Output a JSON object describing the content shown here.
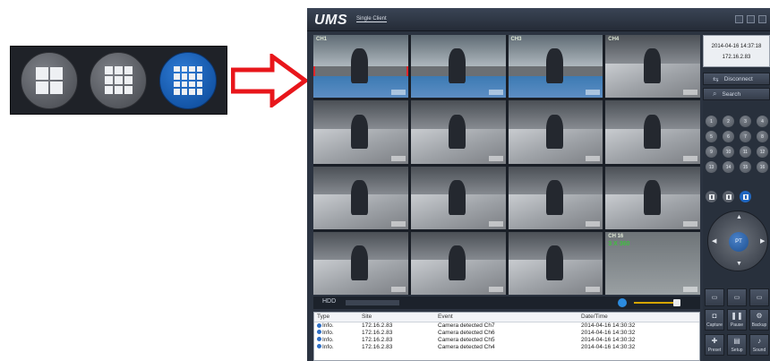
{
  "app": {
    "logo": "UMS",
    "subtitle": "Single Client"
  },
  "layout_buttons": [
    {
      "name": "2x2",
      "active": false
    },
    {
      "name": "3x3",
      "active": false
    },
    {
      "name": "4x4",
      "active": true
    }
  ],
  "cameras": [
    {
      "label": "CH1",
      "osd": "",
      "selected": true,
      "scene": "office"
    },
    {
      "label": "",
      "osd": "",
      "selected": false,
      "scene": "office"
    },
    {
      "label": "CH3",
      "osd": "",
      "selected": false,
      "scene": "office"
    },
    {
      "label": "CH4",
      "osd": "",
      "selected": false,
      "scene": "hall"
    },
    {
      "label": "",
      "osd": "",
      "selected": false,
      "scene": "hall"
    },
    {
      "label": "",
      "osd": "",
      "selected": false,
      "scene": "hall"
    },
    {
      "label": "",
      "osd": "",
      "selected": false,
      "scene": "hall"
    },
    {
      "label": "",
      "osd": "",
      "selected": false,
      "scene": "hall"
    },
    {
      "label": "",
      "osd": "",
      "selected": false,
      "scene": "hall"
    },
    {
      "label": "",
      "osd": "",
      "selected": false,
      "scene": "hall"
    },
    {
      "label": "",
      "osd": "",
      "selected": false,
      "scene": "hall"
    },
    {
      "label": "",
      "osd": "",
      "selected": false,
      "scene": "hall"
    },
    {
      "label": "",
      "osd": "",
      "selected": false,
      "scene": "hall"
    },
    {
      "label": "",
      "osd": "",
      "selected": false,
      "scene": "hall"
    },
    {
      "label": "",
      "osd": "",
      "selected": false,
      "scene": "hall"
    },
    {
      "label": "CH 16",
      "osd": "3 X 360",
      "selected": false,
      "scene": "blank"
    }
  ],
  "status": {
    "hdd_label": "HDD"
  },
  "event_log": {
    "columns": [
      "Type",
      "Site",
      "Event",
      "Date/Time"
    ],
    "rows": [
      [
        "Info.",
        "172.16.2.83",
        "Camera detected Ch7",
        "2014-04-16 14:30:32"
      ],
      [
        "Info.",
        "172.16.2.83",
        "Camera detected Ch6",
        "2014-04-16 14:30:32"
      ],
      [
        "Info.",
        "172.16.2.83",
        "Camera detected Ch5",
        "2014-04-16 14:30:32"
      ],
      [
        "Info.",
        "172.16.2.83",
        "Camera detected Ch4",
        "2014-04-16 14:30:32"
      ]
    ]
  },
  "side_panel": {
    "datetime": "2014-04-16 14:37:18",
    "ip": "172.16.2.83",
    "disconnect_label": "Disconnect",
    "search_label": "Search",
    "channel_numbers": [
      "1",
      "2",
      "3",
      "4",
      "5",
      "6",
      "7",
      "8",
      "9",
      "10",
      "11",
      "12",
      "13",
      "14",
      "15",
      "16"
    ],
    "ptz_label": "PT",
    "controls_row1": [
      "Capture",
      "Pause",
      "Backup"
    ],
    "controls_row2": [
      "Preset",
      "Setup",
      "Sound"
    ]
  },
  "colors": {
    "accent_blue": "#1456a8",
    "selected_border": "#e2262b",
    "arrow_red": "#e8161b"
  }
}
